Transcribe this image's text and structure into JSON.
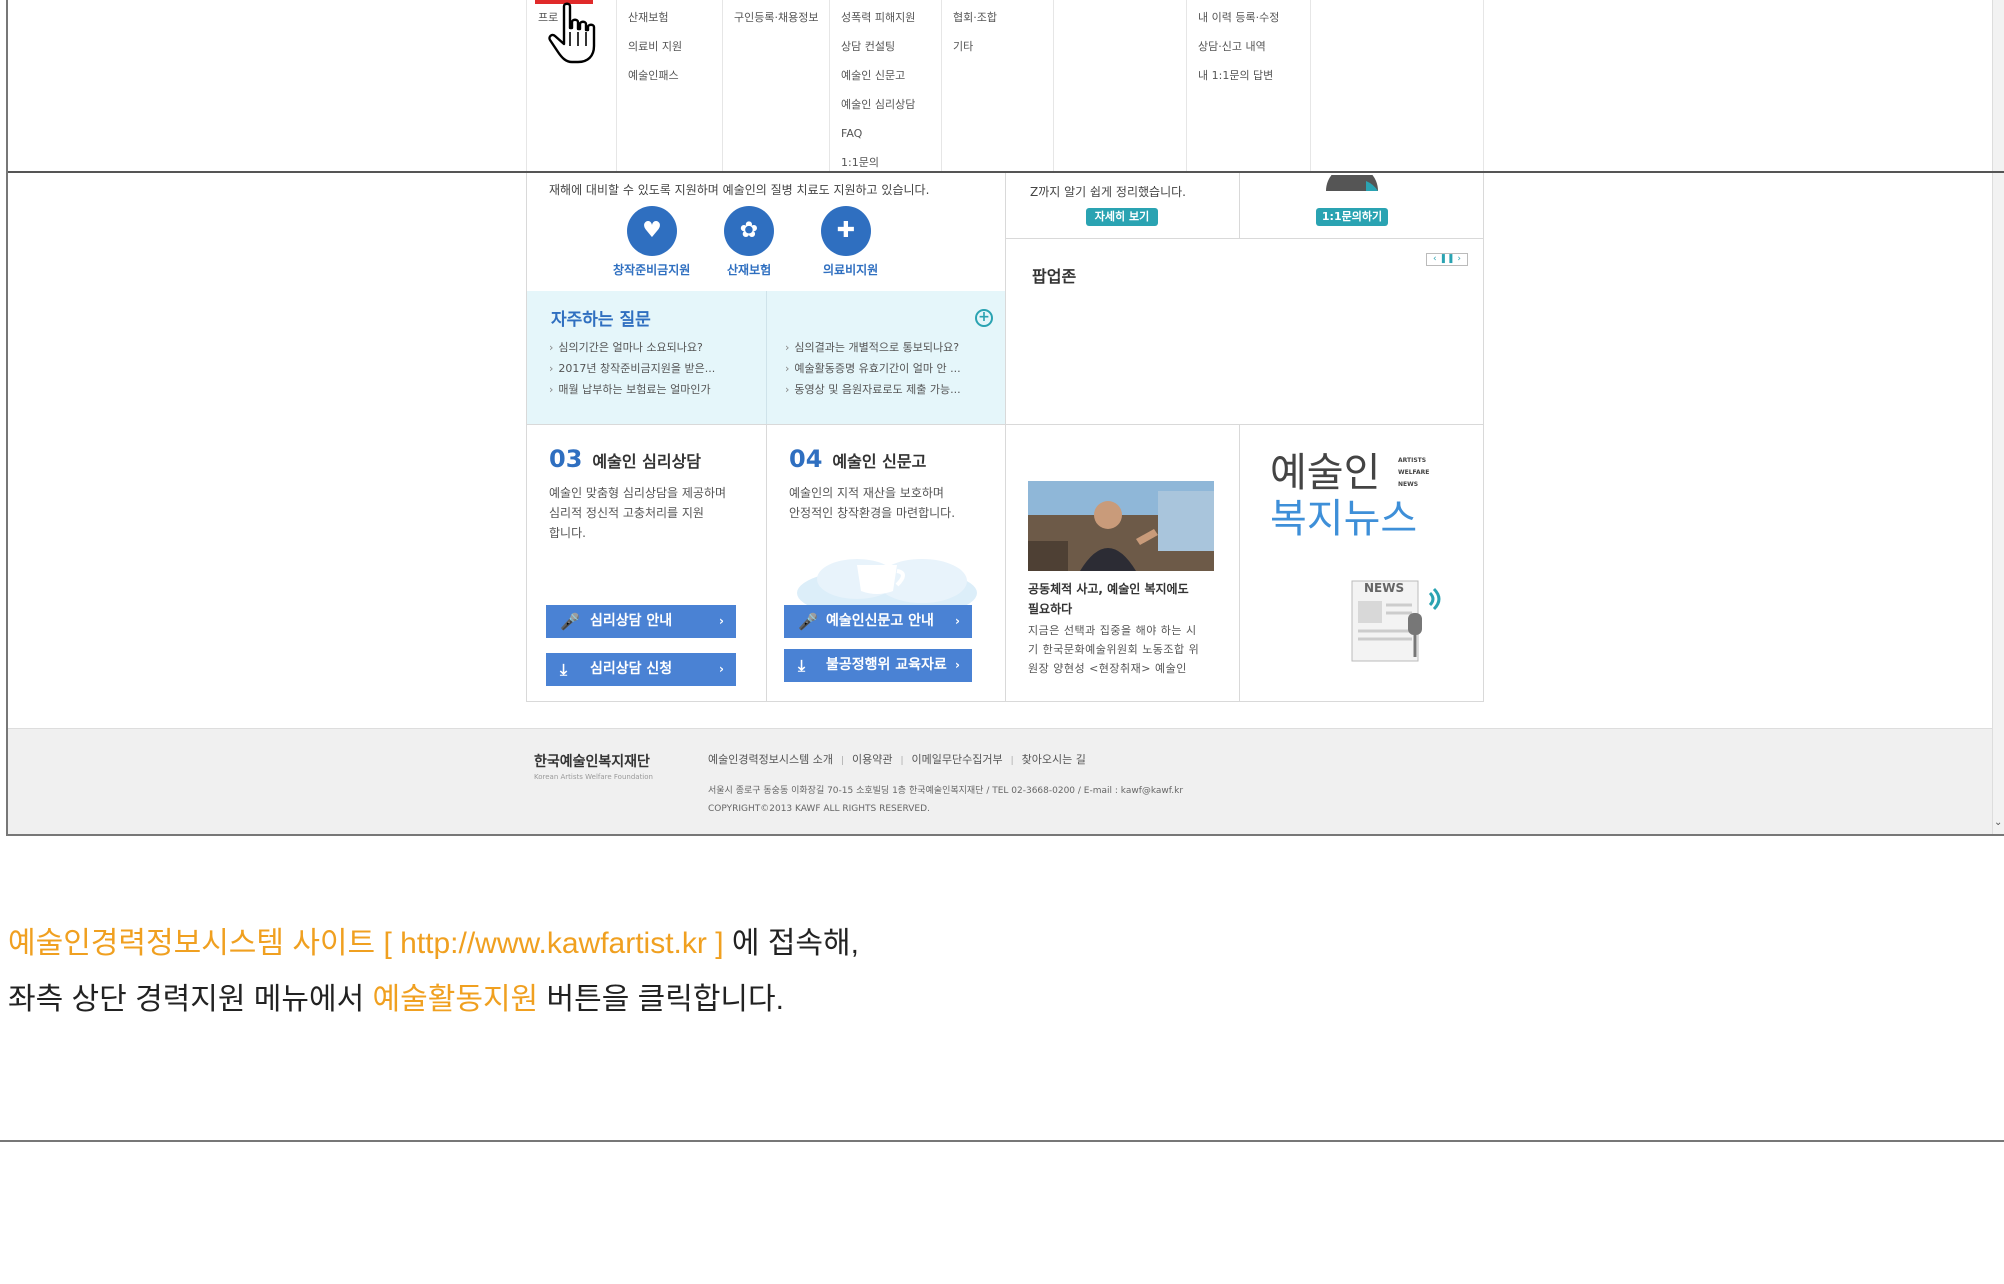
{
  "menu": {
    "col0": [
      "프로"
    ],
    "col1": [
      "산재보험",
      "의료비 지원",
      "예술인패스"
    ],
    "col2": [
      "구인등록·채용정보"
    ],
    "col3": [
      "성폭력 피해지원",
      "상담 컨설팅",
      "예술인 신문고",
      "예술인 심리상담",
      "FAQ",
      "1:1문의"
    ],
    "col4": [
      "협회·조합",
      "기타"
    ],
    "col6": [
      "내 이력 등록·수정",
      "상담·신고 내역",
      "내 1:1문의 답변"
    ]
  },
  "support": {
    "desc": "재해에 대비할 수 있도록 지원하며 예술인의 질병 치료도 지원하고 있습니다.",
    "items": [
      "창작준비금지원",
      "산재보험",
      "의료비지원"
    ]
  },
  "guide": {
    "desc_line": "Z까지 알기 쉽게 정리했습니다.",
    "btn": "자세히 보기"
  },
  "inquiry": {
    "btn": "1:1문의하기"
  },
  "faq": {
    "title": "자주하는 질문",
    "left": [
      "심의기간은 얼마나 소요되나요?",
      "2017년 창작준비금지원을 받은...",
      "매월 납부하는 보험료는 얼마인가"
    ],
    "right": [
      "심의결과는 개별적으로 통보되나요?",
      "예술활동증명 유효기간이 얼마 안 ...",
      "동영상 및 음원자료로도 제출 가능..."
    ]
  },
  "popup": {
    "title": "팝업존"
  },
  "service3": {
    "num": "03",
    "title": "예술인 심리상담",
    "desc": [
      "예술인 맞춤형 심리상담을 제공하며",
      "심리적 정신적 고충처리를 지원",
      "합니다."
    ],
    "btn1": "심리상담 안내",
    "btn2": "심리상담 신청"
  },
  "service4": {
    "num": "04",
    "title": "예술인 신문고",
    "desc": [
      "예술인의 지적 재산을 보호하며",
      "안정적인 창작환경을 마련합니다."
    ],
    "btn1": "예술인신문고 안내",
    "btn2": "불공정행위 교육자료"
  },
  "news": {
    "title": [
      "공동체적 사고, 예술인 복지에도",
      "필요하다"
    ],
    "body": [
      "지금은 선택과 집중을 해야 하는 시",
      "기 한국문화예술위원회 노동조합 위",
      "원장 양현성 <현장취재> 예술인"
    ]
  },
  "newsbrand": {
    "line1": "예술인",
    "line2": "복지뉴스",
    "tags": [
      "ARTISTS",
      "WELFARE",
      "NEWS"
    ],
    "icon_text": "NEWS"
  },
  "footer": {
    "logo": "한국예술인복지재단",
    "logo_en": "Korean Artists Welfare Foundation",
    "links": [
      "예술인경력정보시스템 소개",
      "이용약관",
      "이메일무단수집거부",
      "찾아오시는 길"
    ],
    "address": "서울시 종로구 동숭동 이화장길 70-15 소호빌딩 1층 한국예술인복지재단 / TEL 02-3668-0200 / E-mail : kawf@kawf.kr",
    "copyright": "COPYRIGHT©2013 KAWF ALL RIGHTS RESERVED."
  },
  "caption": {
    "line1_a": "예술인경력정보시스템 사이트 [ http://www.kawfartist.kr ]",
    "line1_b": " 에 접속해,",
    "line2_a": "좌측 상단 경력지원 메뉴에서 ",
    "line2_b": "예술활동지원",
    "line2_c": " 버튼을 클릭합니다."
  },
  "colors": {
    "accent_blue": "#2f6fc0",
    "teal": "#2aa3b2",
    "caption_highlight": "#f0a020",
    "faq_bg": "#e5f6fa"
  }
}
